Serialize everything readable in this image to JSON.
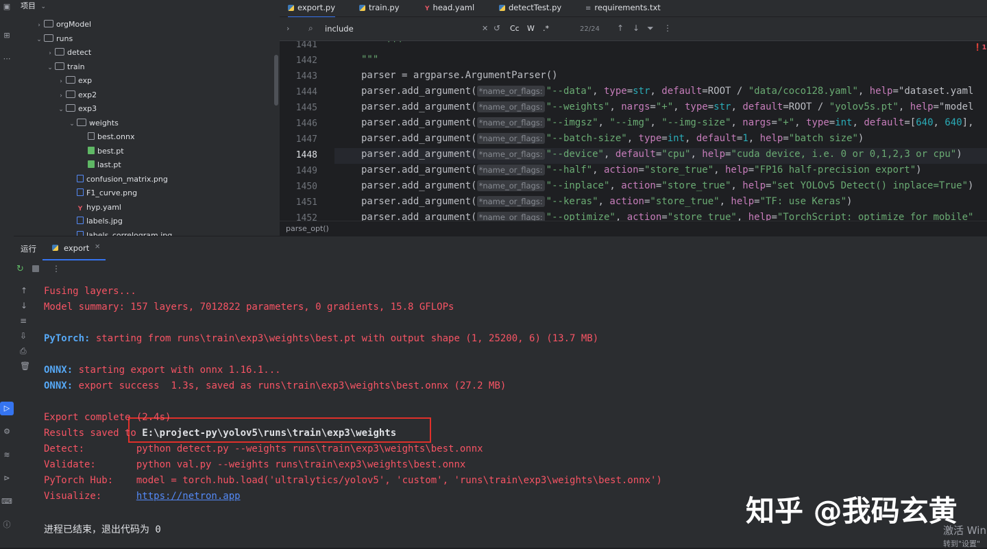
{
  "project": {
    "header": "项目",
    "tree": [
      {
        "label": "orgModel",
        "type": "folder",
        "expanded": false
      },
      {
        "label": "runs",
        "type": "folder",
        "expanded": true
      },
      {
        "label": "detect",
        "type": "folder",
        "expanded": false
      },
      {
        "label": "train",
        "type": "folder",
        "expanded": true
      },
      {
        "label": "exp",
        "type": "folder",
        "expanded": false
      },
      {
        "label": "exp2",
        "type": "folder",
        "expanded": false
      },
      {
        "label": "exp3",
        "type": "folder",
        "expanded": true
      },
      {
        "label": "weights",
        "type": "folder",
        "expanded": true
      },
      {
        "label": "best.onnx",
        "type": "file"
      },
      {
        "label": "best.pt",
        "type": "pt"
      },
      {
        "label": "last.pt",
        "type": "pt"
      },
      {
        "label": "confusion_matrix.png",
        "type": "image"
      },
      {
        "label": "F1_curve.png",
        "type": "image"
      },
      {
        "label": "hyp.yaml",
        "type": "yaml"
      },
      {
        "label": "labels.jpg",
        "type": "image"
      },
      {
        "label": "labels_correlogram.jpg",
        "type": "image"
      }
    ]
  },
  "editor": {
    "tabs": [
      {
        "label": "export.py",
        "icon": "python-icon",
        "active": true
      },
      {
        "label": "train.py",
        "icon": "python-icon",
        "active": false
      },
      {
        "label": "head.yaml",
        "icon": "yaml-icon",
        "active": false
      },
      {
        "label": "detectTest.py",
        "icon": "python-icon",
        "active": false
      },
      {
        "label": "requirements.txt",
        "icon": "text-file-icon",
        "active": false
      }
    ],
    "find": {
      "query": "include",
      "match_count": "22/24",
      "case_label": "Cc",
      "word_label": "W",
      "regex_label": ".*"
    },
    "problems_badge": "1",
    "current_line": "1448",
    "lines": [
      {
        "num": "1441",
        "text": "'''"
      },
      {
        "num": "1442",
        "text": "\"\"\""
      },
      {
        "num": "1443",
        "text": "parser = argparse.ArgumentParser()"
      },
      {
        "num": "1444",
        "hint": "*name_or_flags:",
        "text": "\"--data\", type=str, default=ROOT / \"data/coco128.yaml\", help=\"dataset.yaml"
      },
      {
        "num": "1445",
        "hint": "*name_or_flags:",
        "text": "\"--weights\", nargs=\"+\", type=str, default=ROOT / \"yolov5s.pt\", help=\"model"
      },
      {
        "num": "1446",
        "hint": "*name_or_flags:",
        "text": "\"--imgsz\", \"--img\", \"--img-size\", nargs=\"+\", type=int, default=[640, 640],"
      },
      {
        "num": "1447",
        "hint": "*name_or_flags:",
        "text": "\"--batch-size\", type=int, default=1, help=\"batch size\")"
      },
      {
        "num": "1448",
        "hint": "*name_or_flags:",
        "text": "\"--device\", default=\"cpu\", help=\"cuda device, i.e. 0 or 0,1,2,3 or cpu\")"
      },
      {
        "num": "1449",
        "hint": "*name_or_flags:",
        "text": "\"--half\", action=\"store_true\", help=\"FP16 half-precision export\")"
      },
      {
        "num": "1450",
        "hint": "*name_or_flags:",
        "text": "\"--inplace\", action=\"store_true\", help=\"set YOLOv5 Detect() inplace=True\")"
      },
      {
        "num": "1451",
        "hint": "*name_or_flags:",
        "text": "\"--keras\", action=\"store_true\", help=\"TF: use Keras\")"
      },
      {
        "num": "1452",
        "hint": "*name_or_flags:",
        "text": "\"--optimize\", action=\"store_true\", help=\"TorchScript: optimize for mobile\""
      }
    ],
    "call_prefix": "parser.add_argument(",
    "breadcrumb": "parse_opt()"
  },
  "run_panel": {
    "title": "运行",
    "tab_label": "export",
    "console": [
      {
        "segments": [
          {
            "text": "Fusing layers...",
            "style": "red"
          }
        ]
      },
      {
        "segments": [
          {
            "text": "Model summary: 157 layers, 7012822 parameters, 0 gradients, 15.8 GFLOPs",
            "style": "red"
          }
        ]
      },
      {
        "segments": []
      },
      {
        "segments": [
          {
            "text": "PyTorch:",
            "style": "blue"
          },
          {
            "text": " starting from runs\\train\\exp3\\weights\\best.pt with output shape (1, 25200, 6) (13.7 MB)",
            "style": "red"
          }
        ]
      },
      {
        "segments": []
      },
      {
        "segments": [
          {
            "text": "ONNX:",
            "style": "blue"
          },
          {
            "text": " starting export with onnx 1.16.1...",
            "style": "red"
          }
        ]
      },
      {
        "segments": [
          {
            "text": "ONNX:",
            "style": "blue"
          },
          {
            "text": " export success  1.3s, saved as runs\\train\\exp3\\weights\\best.onnx (27.2 MB)",
            "style": "red"
          }
        ]
      },
      {
        "segments": []
      },
      {
        "segments": [
          {
            "text": "Export complete (2.4s)",
            "style": "red"
          }
        ]
      },
      {
        "segments": [
          {
            "text": "Results saved to ",
            "style": "red"
          },
          {
            "text": "E:\\project-py\\yolov5\\runs\\train\\exp3\\weights",
            "style": "white-bold"
          }
        ]
      },
      {
        "segments": [
          {
            "text": "Detect:         ",
            "style": "red"
          },
          {
            "text": "python detect.py --weights runs\\train\\exp3\\weights\\best.onnx",
            "style": "red"
          }
        ]
      },
      {
        "segments": [
          {
            "text": "Validate:       ",
            "style": "red"
          },
          {
            "text": "python val.py --weights runs\\train\\exp3\\weights\\best.onnx",
            "style": "red"
          }
        ]
      },
      {
        "segments": [
          {
            "text": "PyTorch Hub:    ",
            "style": "red"
          },
          {
            "text": "model = torch.hub.load('ultralytics/yolov5', 'custom', 'runs\\train\\exp3\\weights\\best.onnx')",
            "style": "red"
          }
        ]
      },
      {
        "segments": [
          {
            "text": "Visualize:      ",
            "style": "red"
          },
          {
            "text": "https://netron.app",
            "style": "link"
          }
        ]
      },
      {
        "segments": []
      },
      {
        "segments": [
          {
            "text": "进程已结束，退出代码为 0",
            "style": "white"
          }
        ]
      }
    ]
  },
  "watermark": "知乎 @我码玄黄",
  "activation": {
    "line1": "激活 Win",
    "line2": "转到\"设置\""
  }
}
